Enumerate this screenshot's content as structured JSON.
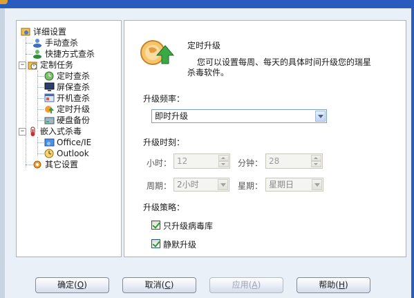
{
  "tree": {
    "root": "详细设置",
    "manual_scan": "手动查杀",
    "shortcut_scan": "快捷方式查杀",
    "scheduled_tasks": "定制任务",
    "timed_scan": "定时查杀",
    "screensaver_scan": "屏保查杀",
    "startup_scan": "开机查杀",
    "timed_upgrade": "定时升级",
    "disk_backup": "硬盘备份",
    "embedded_scan": "嵌入式杀毒",
    "office_ie": "Office/IE",
    "outlook": "Outlook",
    "other_settings": "其它设置"
  },
  "content": {
    "title": "定时升级",
    "description": "您可以设置每周、每天的具体时间升级您的瑞星杀毒软件。",
    "frequency_label": "升级频率：",
    "frequency_value": "即时升级",
    "time_label": "升级时刻：",
    "hour_label": "小时：",
    "hour_value": "12",
    "minute_label": "分钟：",
    "minute_value": "28",
    "period_label": "周期：",
    "period_value": "2小时",
    "weekday_label": "星期：",
    "weekday_value": "星期日",
    "strategy_label": "升级策略：",
    "virus_only_label": "只升级病毒库",
    "virus_only_checked": true,
    "silent_label": "静默升级",
    "silent_checked": true
  },
  "buttons": {
    "ok": "确定",
    "ok_key": "O",
    "cancel": "取消",
    "cancel_key": "C",
    "apply": "应用",
    "apply_key": "A",
    "help": "帮助",
    "help_key": "H"
  }
}
